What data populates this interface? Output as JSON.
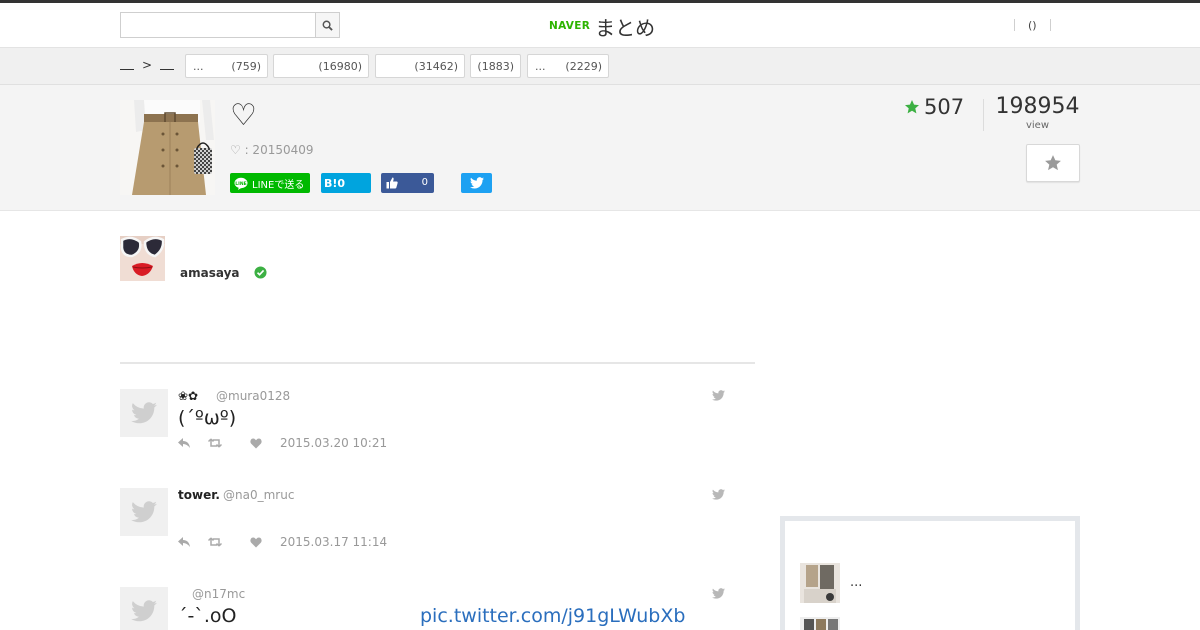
{
  "header": {
    "search": {
      "value": "",
      "placeholder": ""
    },
    "logo": {
      "naver": "NAVER",
      "matome": "まとめ"
    },
    "right_link": "()"
  },
  "categories": {
    "breadcrumb": {
      "separator": ">"
    },
    "tabs": [
      {
        "name": "...",
        "count": "(759)"
      },
      {
        "name": "",
        "count": "(16980)"
      },
      {
        "name": "",
        "count": "(31462)"
      },
      {
        "name": "",
        "count": "(1883)"
      },
      {
        "name": "...",
        "count": "(2229)"
      }
    ]
  },
  "matome": {
    "title": "♡",
    "date_line": "♡ : 20150409",
    "share": {
      "line_label": "LINEで送る",
      "hatena_label": "B!0",
      "facebook_count": "0"
    },
    "favorites": "507",
    "views": "198954",
    "views_label": "view"
  },
  "author": {
    "name": "amasaya"
  },
  "tweets": [
    {
      "name": "❀✿",
      "handle": "@mura0128",
      "text": "(´ºωº)",
      "time": "2015.03.20 10:21",
      "link": ""
    },
    {
      "name": "tower.",
      "handle": "@na0_mruc",
      "text": "",
      "time": "2015.03.17 11:14",
      "link": ""
    },
    {
      "name": "",
      "handle": "@n17mc",
      "text": "´-`.oO",
      "time": "",
      "link": "pic.twitter.com/j91gLWubXb"
    }
  ],
  "sidebar": {
    "items": [
      {
        "text": "..."
      },
      {
        "text": ""
      }
    ]
  },
  "colors": {
    "naver_green": "#2db400",
    "fav_star": "#3cb043",
    "line": "#00b900",
    "hatena": "#00a4de",
    "facebook": "#3b5998",
    "twitter": "#1da1f2",
    "link": "#2a6ebd"
  },
  "icons": {
    "search": "search-icon",
    "star": "star-icon",
    "twitter": "twitter-bird-icon",
    "reply": "reply-icon",
    "retweet": "retweet-icon",
    "like": "heart-icon",
    "verified": "verified-check-icon"
  }
}
